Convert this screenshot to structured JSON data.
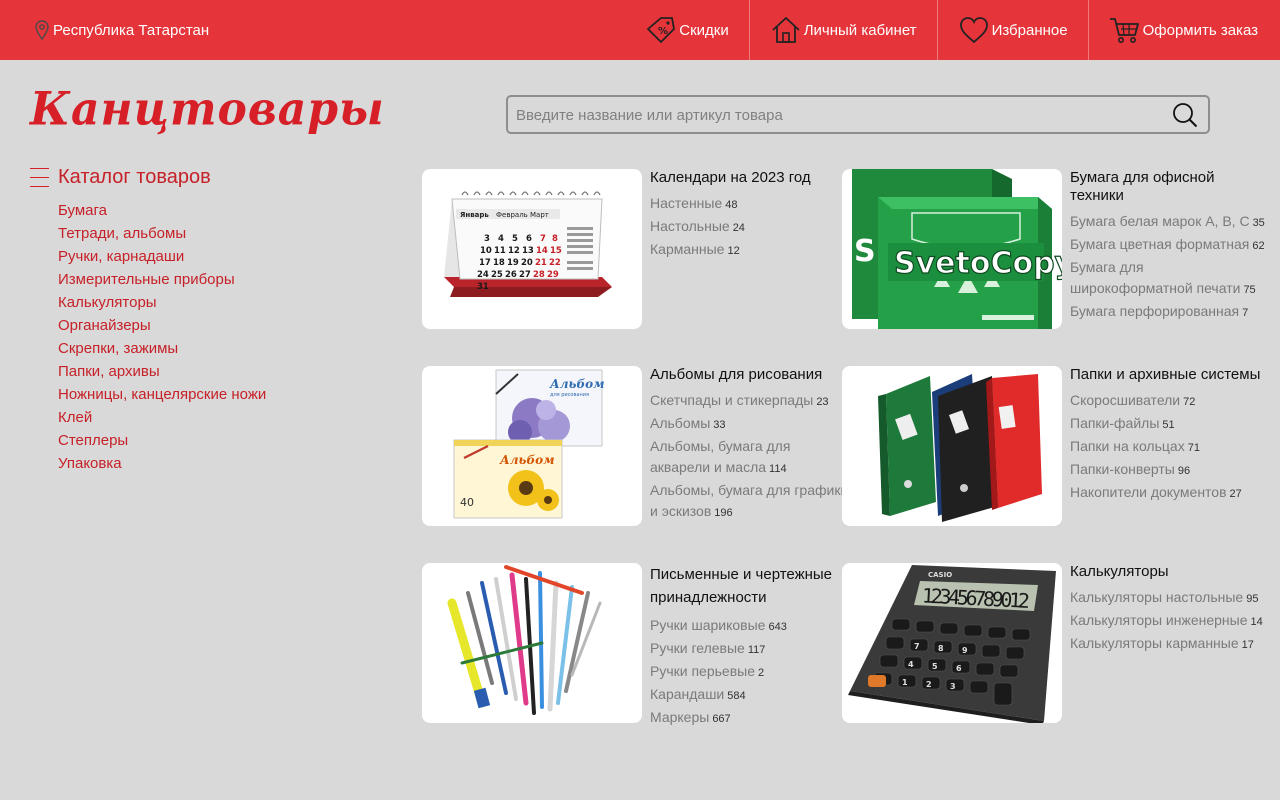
{
  "header": {
    "region": "Республика Татарстан",
    "nav": [
      {
        "label": "Скидки",
        "icon": "discount-tag-icon"
      },
      {
        "label": "Личный кабинет",
        "icon": "home-icon"
      },
      {
        "label": "Избранное",
        "icon": "heart-icon"
      },
      {
        "label": "Оформить заказ",
        "icon": "cart-icon"
      }
    ]
  },
  "logo": "Канцтовары",
  "search": {
    "placeholder": "Введите название или артикул товара"
  },
  "sidebar": {
    "title": "Каталог товаров",
    "items": [
      "Бумага",
      "Тетради, альбомы",
      "Ручки, карнадаши",
      "Измерительные приборы",
      "Калькуляторы",
      "Органайзеры",
      "Скрепки, зажимы",
      "Папки, архивы",
      "Ножницы, канцелярские ножи",
      "Клей",
      "Степлеры",
      "Упаковка"
    ]
  },
  "categories": [
    {
      "title": "Календари на 2023 год",
      "image": "calendar",
      "items": [
        {
          "name": "Настенные",
          "count": "48"
        },
        {
          "name": "Настольные",
          "count": "24"
        },
        {
          "name": "Карманные",
          "count": "12"
        }
      ]
    },
    {
      "title": "Бумага для офисной техники",
      "image": "paper",
      "items": [
        {
          "name": "Бумага белая марок A, B, C",
          "count": "35"
        },
        {
          "name": "Бумага цветная форматная",
          "count": "62"
        },
        {
          "name": "Бумага для широкоформатной печати",
          "count": "75"
        },
        {
          "name": "Бумага перфорированная",
          "count": "7"
        }
      ]
    },
    {
      "title": "Альбомы для рисования",
      "image": "albums",
      "items": [
        {
          "name": "Скетчпады и стикерпады",
          "count": "23"
        },
        {
          "name": "Альбомы",
          "count": "33"
        },
        {
          "name": "Альбомы, бумага для акварели и масла",
          "count": "114"
        },
        {
          "name": "Альбомы, бумага для графики и эскизов",
          "count": "196"
        }
      ]
    },
    {
      "title": "Папки и архивные системы",
      "image": "folders",
      "items": [
        {
          "name": "Скоросшиватели",
          "count": "72"
        },
        {
          "name": "Папки-файлы",
          "count": "51"
        },
        {
          "name": "Папки на кольцах",
          "count": "71"
        },
        {
          "name": "Папки-конверты",
          "count": "96"
        },
        {
          "name": "Накопители документов",
          "count": "27"
        }
      ]
    },
    {
      "title": "Письменные и чертежные принадлежности",
      "image": "pens",
      "items": [
        {
          "name": "Ручки шариковые",
          "count": "643"
        },
        {
          "name": "Ручки гелевые",
          "count": "117"
        },
        {
          "name": "Ручки перьевые",
          "count": "2"
        },
        {
          "name": "Карандаши",
          "count": "584"
        },
        {
          "name": "Маркеры",
          "count": "667"
        }
      ]
    },
    {
      "title": "Калькуляторы",
      "image": "calculator",
      "items": [
        {
          "name": "Калькуляторы настольные",
          "count": "95"
        },
        {
          "name": "Калькуляторы инженерные",
          "count": "14"
        },
        {
          "name": "Калькуляторы карманные",
          "count": "17"
        }
      ]
    }
  ],
  "image_text": {
    "calendar_months": [
      "Январь",
      "Февраль",
      "Март"
    ],
    "calendar_days": [
      "3",
      "4",
      "5",
      "6",
      "7",
      "8",
      "10",
      "11",
      "12",
      "13",
      "14",
      "15",
      "17",
      "18",
      "19",
      "20",
      "21",
      "22",
      "24",
      "25",
      "26",
      "27",
      "28",
      "29",
      "31"
    ],
    "paper_brand": "SvetoCopy",
    "album_title": "Альбом",
    "album_subtitle": "для рисования",
    "album_sheets": "40",
    "calc_brand": "CASIO",
    "calc_display": "123456789012"
  },
  "colors": {
    "brand_red": "#e5343a",
    "link_red": "#c62128",
    "background": "#d9d9d9"
  }
}
